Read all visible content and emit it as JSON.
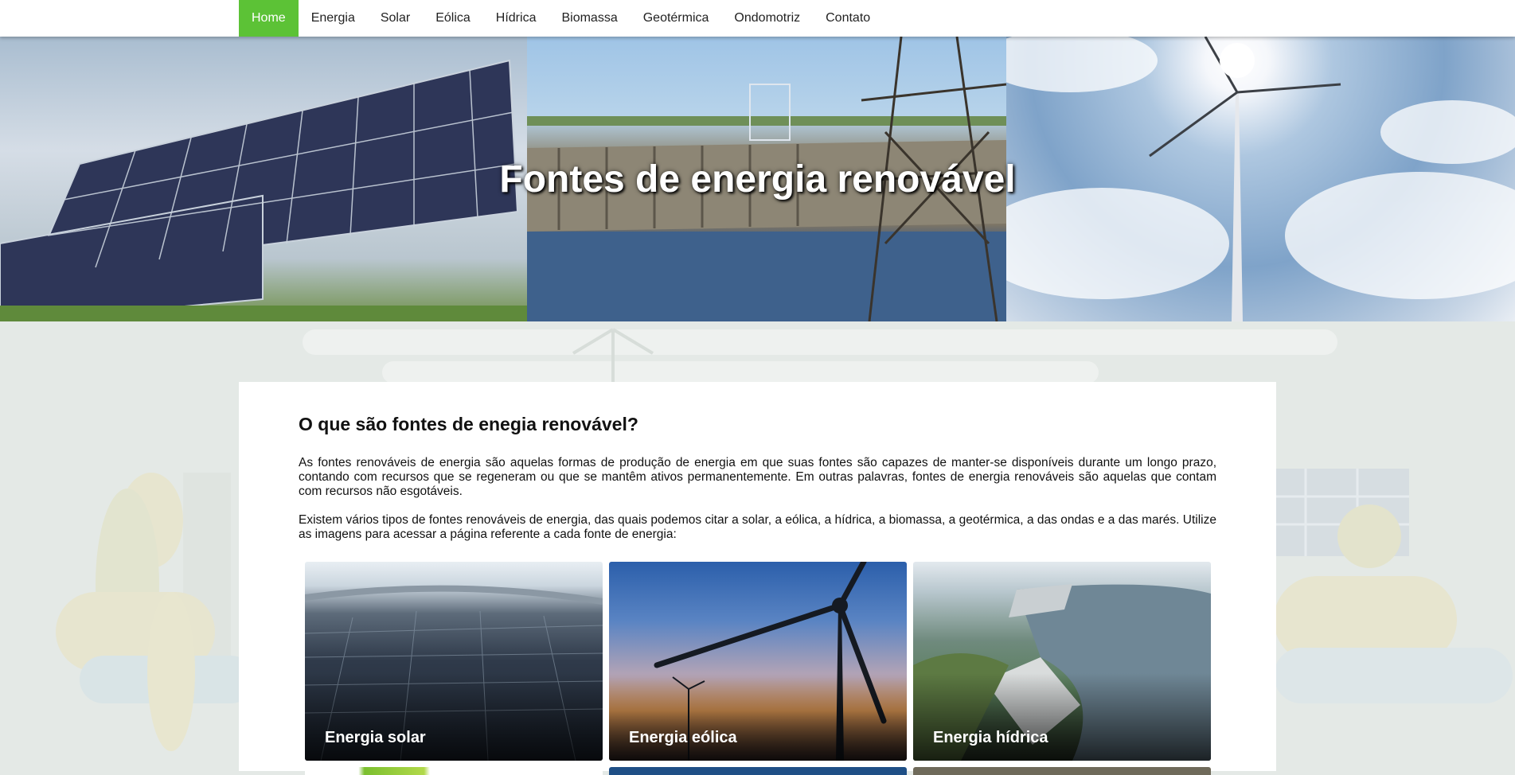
{
  "nav": {
    "items": [
      {
        "label": "Home",
        "active": true
      },
      {
        "label": "Energia",
        "active": false
      },
      {
        "label": "Solar",
        "active": false
      },
      {
        "label": "Eólica",
        "active": false
      },
      {
        "label": "Hídrica",
        "active": false
      },
      {
        "label": "Biomassa",
        "active": false
      },
      {
        "label": "Geotérmica",
        "active": false
      },
      {
        "label": "Ondomotriz",
        "active": false
      },
      {
        "label": "Contato",
        "active": false
      }
    ],
    "active_color": "#5cc236"
  },
  "hero": {
    "title": "Fontes de energia renovável",
    "images": [
      "solar-panels-photo",
      "hydroelectric-dam-photo",
      "wind-turbine-photo"
    ]
  },
  "main": {
    "heading": "O que são fontes de enegia renovável?",
    "paragraph1": "As fontes renováveis de energia são aquelas formas de produção de energia em que suas fontes são capazes de manter-se disponíveis durante um longo prazo, contando com recursos que se regeneram ou que se mantêm ativos permanentemente. Em outras palavras, fontes de energia renováveis são aquelas que contam com recursos não esgotáveis.",
    "paragraph2": "Existem vários tipos de fontes renováveis de energia, das quais podemos citar a solar, a eólica, a hídrica, a biomassa, a geotérmica, a das ondas e a das marés. Utilize as imagens para acessar a página referente a cada fonte de energia:",
    "tiles": [
      {
        "label": "Energia solar"
      },
      {
        "label": "Energia eólica"
      },
      {
        "label": "Energia hídrica"
      }
    ]
  }
}
